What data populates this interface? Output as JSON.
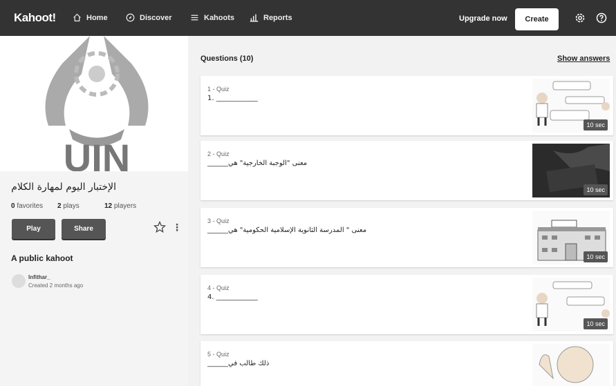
{
  "topbar": {
    "logo": "Kahoot!",
    "nav": [
      {
        "label": "Home",
        "icon": "home-icon"
      },
      {
        "label": "Discover",
        "icon": "compass-icon"
      },
      {
        "label": "Kahoots",
        "icon": "list-icon"
      },
      {
        "label": "Reports",
        "icon": "bar-chart-icon"
      }
    ],
    "upgrade": "Upgrade now",
    "create": "Create"
  },
  "kahoot": {
    "title": "الإختبار اليوم لمهارة الكلام",
    "favorites_count": "0",
    "favorites_label": "favorites",
    "plays_count": "2",
    "plays_label": "plays",
    "players_count": "12",
    "players_label": "players",
    "play_label": "Play",
    "share_label": "Share",
    "visibility": "A public kahoot",
    "author": "Infithar_",
    "created": "Created 2 months ago",
    "cover_text": "UIN"
  },
  "questions": {
    "header": "Questions (10)",
    "show_answers": "Show answers",
    "items": [
      {
        "type": "1 - Quiz",
        "text": "1. ____________",
        "time": "10 sec"
      },
      {
        "type": "2 - Quiz",
        "text": "______معنى \"الوجبة الخارجية\" هي",
        "time": "10 sec"
      },
      {
        "type": "3 - Quiz",
        "text": "______معنى \" المدرسة الثانوية الإسلامية الحكومية\" هي",
        "time": "10 sec"
      },
      {
        "type": "4 - Quiz",
        "text": "4. ____________",
        "time": "10 sec"
      },
      {
        "type": "5 - Quiz",
        "text": "______ذلك طالب في",
        "time": ""
      }
    ]
  },
  "colors": {
    "topbar": "#333333",
    "button": "#555555",
    "background": "#f2f2f2"
  }
}
